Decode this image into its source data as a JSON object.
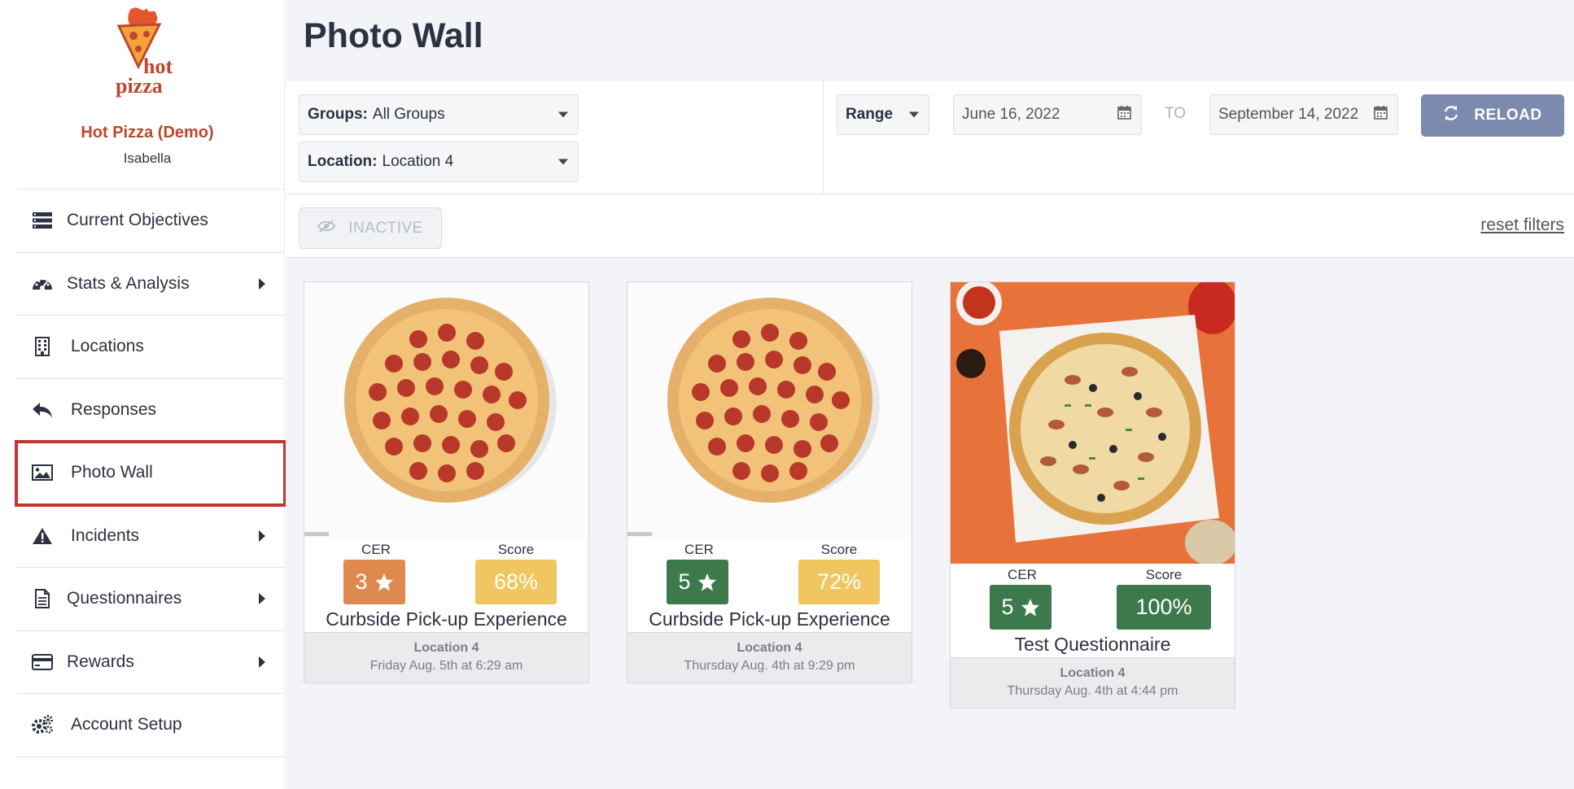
{
  "brand": {
    "logo_text_line1": "hot",
    "logo_text_line2": "pizza",
    "org_name": "Hot Pizza (Demo)",
    "user_name": "Isabella",
    "accent_color": "#c0462c"
  },
  "sidebar": {
    "items": [
      {
        "label": "Current Objectives",
        "icon": "list-icon",
        "has_submenu": false
      },
      {
        "label": "Stats & Analysis",
        "icon": "dashboard-icon",
        "has_submenu": true
      },
      {
        "label": "Locations",
        "icon": "building-icon",
        "has_submenu": false
      },
      {
        "label": "Responses",
        "icon": "reply-icon",
        "has_submenu": false
      },
      {
        "label": "Photo Wall",
        "icon": "image-icon",
        "has_submenu": false,
        "active": true
      },
      {
        "label": "Incidents",
        "icon": "warning-icon",
        "has_submenu": true
      },
      {
        "label": "Questionnaires",
        "icon": "document-icon",
        "has_submenu": true
      },
      {
        "label": "Rewards",
        "icon": "credit-card-icon",
        "has_submenu": true
      },
      {
        "label": "Account Setup",
        "icon": "gears-icon",
        "has_submenu": false
      }
    ]
  },
  "page": {
    "title": "Photo Wall"
  },
  "filters": {
    "groups_label": "Groups:",
    "groups_value": "All Groups",
    "location_label": "Location:",
    "location_value": "Location 4",
    "range_label": "Range",
    "date_from": "June 16, 2022",
    "to_label": "TO",
    "date_to": "September 14, 2022",
    "reload_label": "RELOAD",
    "inactive_label": "INACTIVE",
    "reset_label": "reset filters"
  },
  "cards": [
    {
      "cer_label": "CER",
      "cer_value": "3",
      "cer_color": "#e0894f",
      "score_label": "Score",
      "score_value": "68%",
      "score_color": "#efc65f",
      "title": "Curbside Pick-up Experience",
      "location": "Location 4",
      "time": "Friday Aug. 5th at 6:29 am"
    },
    {
      "cer_label": "CER",
      "cer_value": "5",
      "cer_color": "#3c7a4c",
      "score_label": "Score",
      "score_value": "72%",
      "score_color": "#efc65f",
      "title": "Curbside Pick-up Experience",
      "location": "Location 4",
      "time": "Thursday Aug. 4th at 9:29 pm"
    },
    {
      "cer_label": "CER",
      "cer_value": "5",
      "cer_color": "#3c7a4c",
      "score_label": "Score",
      "score_value": "100%",
      "score_color": "#3c7a4c",
      "title": "Test Questionnaire",
      "location": "Location 4",
      "time": "Thursday Aug. 4th at 4:44 pm"
    }
  ]
}
